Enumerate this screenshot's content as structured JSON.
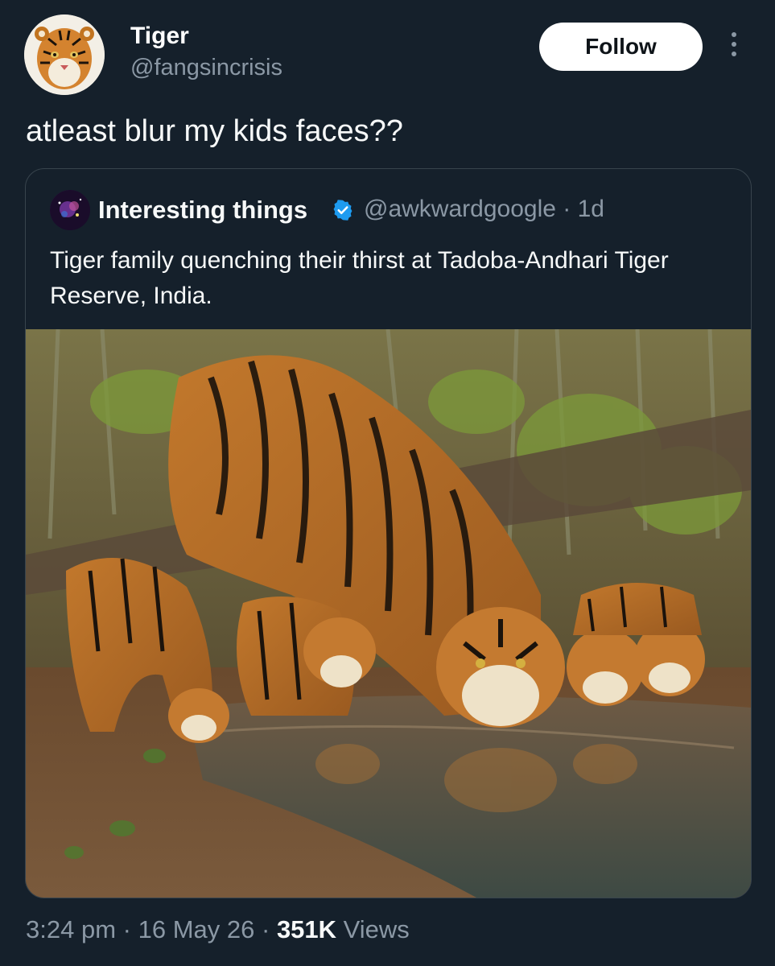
{
  "author": {
    "display_name": "Tiger",
    "handle": "@fangsincrisis",
    "avatar_icon": "tiger-face-avatar"
  },
  "follow_label": "Follow",
  "tweet_text": "atleast blur my kids faces??",
  "quoted": {
    "display_name": "Interesting things",
    "verified": true,
    "handle": "@awkwardgoogle",
    "separator": "·",
    "age": "1d",
    "text": "Tiger family quenching their thirst at Tadoba-Andhari Tiger Reserve, India.",
    "media_icon": "tiger-family-photo"
  },
  "footer": {
    "time": "3:24 pm",
    "separator": "·",
    "date": "16 May 26",
    "views_count": "351K",
    "views_label": "Views"
  },
  "colors": {
    "background": "#15202b",
    "secondary_text": "#8b98a5",
    "verified_blue": "#1d9bf0",
    "border": "#38444d"
  }
}
